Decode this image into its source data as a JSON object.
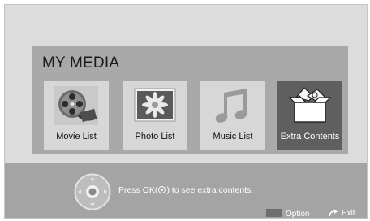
{
  "media": {
    "title": "MY MEDIA",
    "selected_index": 3,
    "tiles": [
      {
        "label": "Movie List",
        "icon": "film-reel-icon"
      },
      {
        "label": "Photo List",
        "icon": "photo-flower-icon"
      },
      {
        "label": "Music List",
        "icon": "music-note-icon"
      },
      {
        "label": "Extra Contents",
        "icon": "extra-contents-box-icon"
      }
    ]
  },
  "hint": {
    "prefix": "Press OK(",
    "suffix": ") to see extra contents.",
    "icon": "ok-button-icon"
  },
  "footer": {
    "option_label": "Option",
    "exit_label": "Exit",
    "option_icon": "option-swatch-icon",
    "exit_icon": "back-arrow-icon"
  },
  "colors": {
    "screen_bg": "#dcdcdc",
    "panel_bg": "#a9a9a9",
    "tile_bg": "#d7d7d7",
    "selected_tile_bg": "#5f5f5f",
    "info_bar_bg": "#a4a4a4"
  }
}
